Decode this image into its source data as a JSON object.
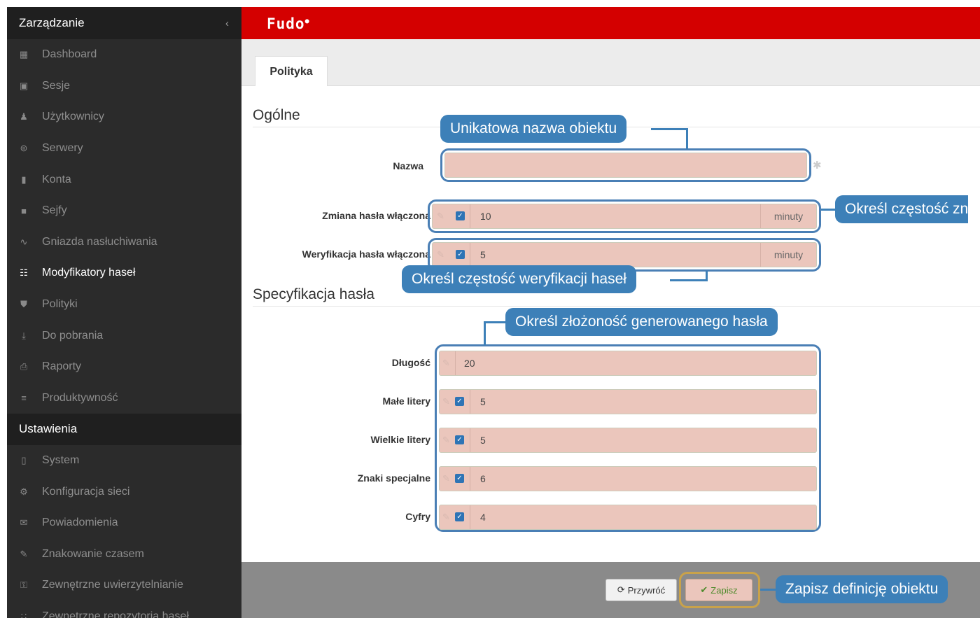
{
  "sidebar": {
    "management_title": "Zarządzanie",
    "collapse_icon": "chevron-left-icon",
    "items": [
      {
        "label": "Dashboard",
        "icon": "bar-chart-icon"
      },
      {
        "label": "Sesje",
        "icon": "film-icon"
      },
      {
        "label": "Użytkownicy",
        "icon": "users-icon"
      },
      {
        "label": "Serwery",
        "icon": "server-icon"
      },
      {
        "label": "Konta",
        "icon": "book-icon"
      },
      {
        "label": "Sejfy",
        "icon": "safe-icon"
      },
      {
        "label": "Gniazda nasłuchiwania",
        "icon": "rss-icon"
      },
      {
        "label": "Modyfikatory haseł",
        "icon": "sitemap-icon",
        "active": true
      },
      {
        "label": "Polityki",
        "icon": "shield-icon"
      },
      {
        "label": "Do pobrania",
        "icon": "download-icon"
      },
      {
        "label": "Raporty",
        "icon": "print-icon"
      },
      {
        "label": "Produktywność",
        "icon": "list-icon"
      }
    ],
    "settings_title": "Ustawienia",
    "settings_items": [
      {
        "label": "System",
        "icon": "folder-icon"
      },
      {
        "label": "Konfiguracja sieci",
        "icon": "cogs-icon"
      },
      {
        "label": "Powiadomienia",
        "icon": "envelope-icon"
      },
      {
        "label": "Znakowanie czasem",
        "icon": "edit-icon"
      },
      {
        "label": "Zewnętrzne uwierzytelnianie",
        "icon": "key-icon"
      },
      {
        "label": "Zewnętrzne repozytoria haseł",
        "icon": "grid-icon"
      }
    ]
  },
  "header": {
    "logo": "Fudo"
  },
  "tabs": [
    {
      "label": "Polityka"
    }
  ],
  "form": {
    "general_title": "Ogólne",
    "name_label": "Nazwa",
    "name_value": "",
    "change_label": "Zmiana hasła włączona",
    "change_value": "10",
    "change_unit": "minuty",
    "verify_label": "Weryfikacja hasła włączona",
    "verify_value": "5",
    "verify_unit": "minuty",
    "spec_title": "Specyfikacja hasła",
    "length_label": "Długość",
    "length_value": "20",
    "lower_label": "Małe litery",
    "lower_value": "5",
    "upper_label": "Wielkie litery",
    "upper_value": "5",
    "special_label": "Znaki specjalne",
    "special_value": "6",
    "digits_label": "Cyfry",
    "digits_value": "4"
  },
  "callouts": {
    "name": "Unikatowa nazwa obiektu",
    "change": "Określ częstość zn",
    "verify": "Określ częstość weryfikacji haseł",
    "complexity": "Określ złożoność generowanego hasła",
    "save": "Zapisz definicję obiektu"
  },
  "footer": {
    "reset_label": "Przywróć",
    "save_label": "Zapisz"
  },
  "colors": {
    "header": "#d40000",
    "sidebar": "#2b2b2b",
    "callout": "#3d80b8",
    "highlight_field": "#ebc6bc"
  }
}
